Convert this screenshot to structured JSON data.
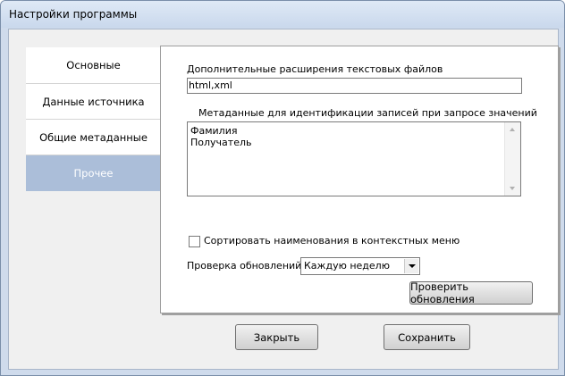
{
  "window": {
    "title": "Настройки программы"
  },
  "tabs": [
    {
      "label": "Основные",
      "active": false
    },
    {
      "label": "Данные источника",
      "active": false
    },
    {
      "label": "Общие метаданные",
      "active": false
    },
    {
      "label": "Прочее",
      "active": true
    }
  ],
  "panel": {
    "extensions_label": "Дополнительные расширения текстовых файлов",
    "extensions_value": "html,xml",
    "metadata_label": "Метаданные для идентификации записей при запросе значений",
    "metadata_items": [
      "Фамилия",
      "Получатель"
    ],
    "sort_checkbox_label": "Сортировать наименования  в контекстных меню",
    "sort_checkbox_checked": false,
    "update_check_label": "Проверка обновлений:",
    "update_check_value": "Каждую неделю",
    "check_updates_button": "Проверить обновления"
  },
  "footer": {
    "close_button": "Закрыть",
    "save_button": "Сохранить"
  },
  "colors": {
    "active_tab": "#abbed9",
    "window_frame": "#cfdbec"
  }
}
